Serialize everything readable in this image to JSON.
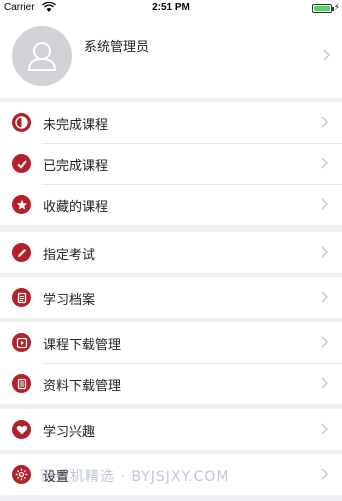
{
  "status_bar": {
    "carrier": "Carrier",
    "time": "2:51 PM"
  },
  "profile": {
    "name": "系统管理员",
    "avatar_icon": "user-avatar-icon"
  },
  "accent_color": "#b2212a",
  "menu_groups": [
    {
      "items": [
        {
          "label": "未完成课程",
          "icon": "half-circle-icon"
        },
        {
          "label": "已完成课程",
          "icon": "check-icon"
        },
        {
          "label": "收藏的课程",
          "icon": "star-icon"
        }
      ]
    },
    {
      "items": [
        {
          "label": "指定考试",
          "icon": "pencil-icon"
        }
      ]
    },
    {
      "items": [
        {
          "label": "学习档案",
          "icon": "document-icon"
        }
      ]
    },
    {
      "items": [
        {
          "label": "课程下载管理",
          "icon": "play-download-icon"
        },
        {
          "label": "资料下载管理",
          "icon": "file-download-icon"
        }
      ]
    },
    {
      "items": [
        {
          "label": "学习兴趣",
          "icon": "heart-icon"
        }
      ]
    },
    {
      "items": [
        {
          "label": "设置",
          "icon": "gear-icon"
        }
      ]
    }
  ],
  "watermark": "百手机精选 · BYJSJXY.COM"
}
